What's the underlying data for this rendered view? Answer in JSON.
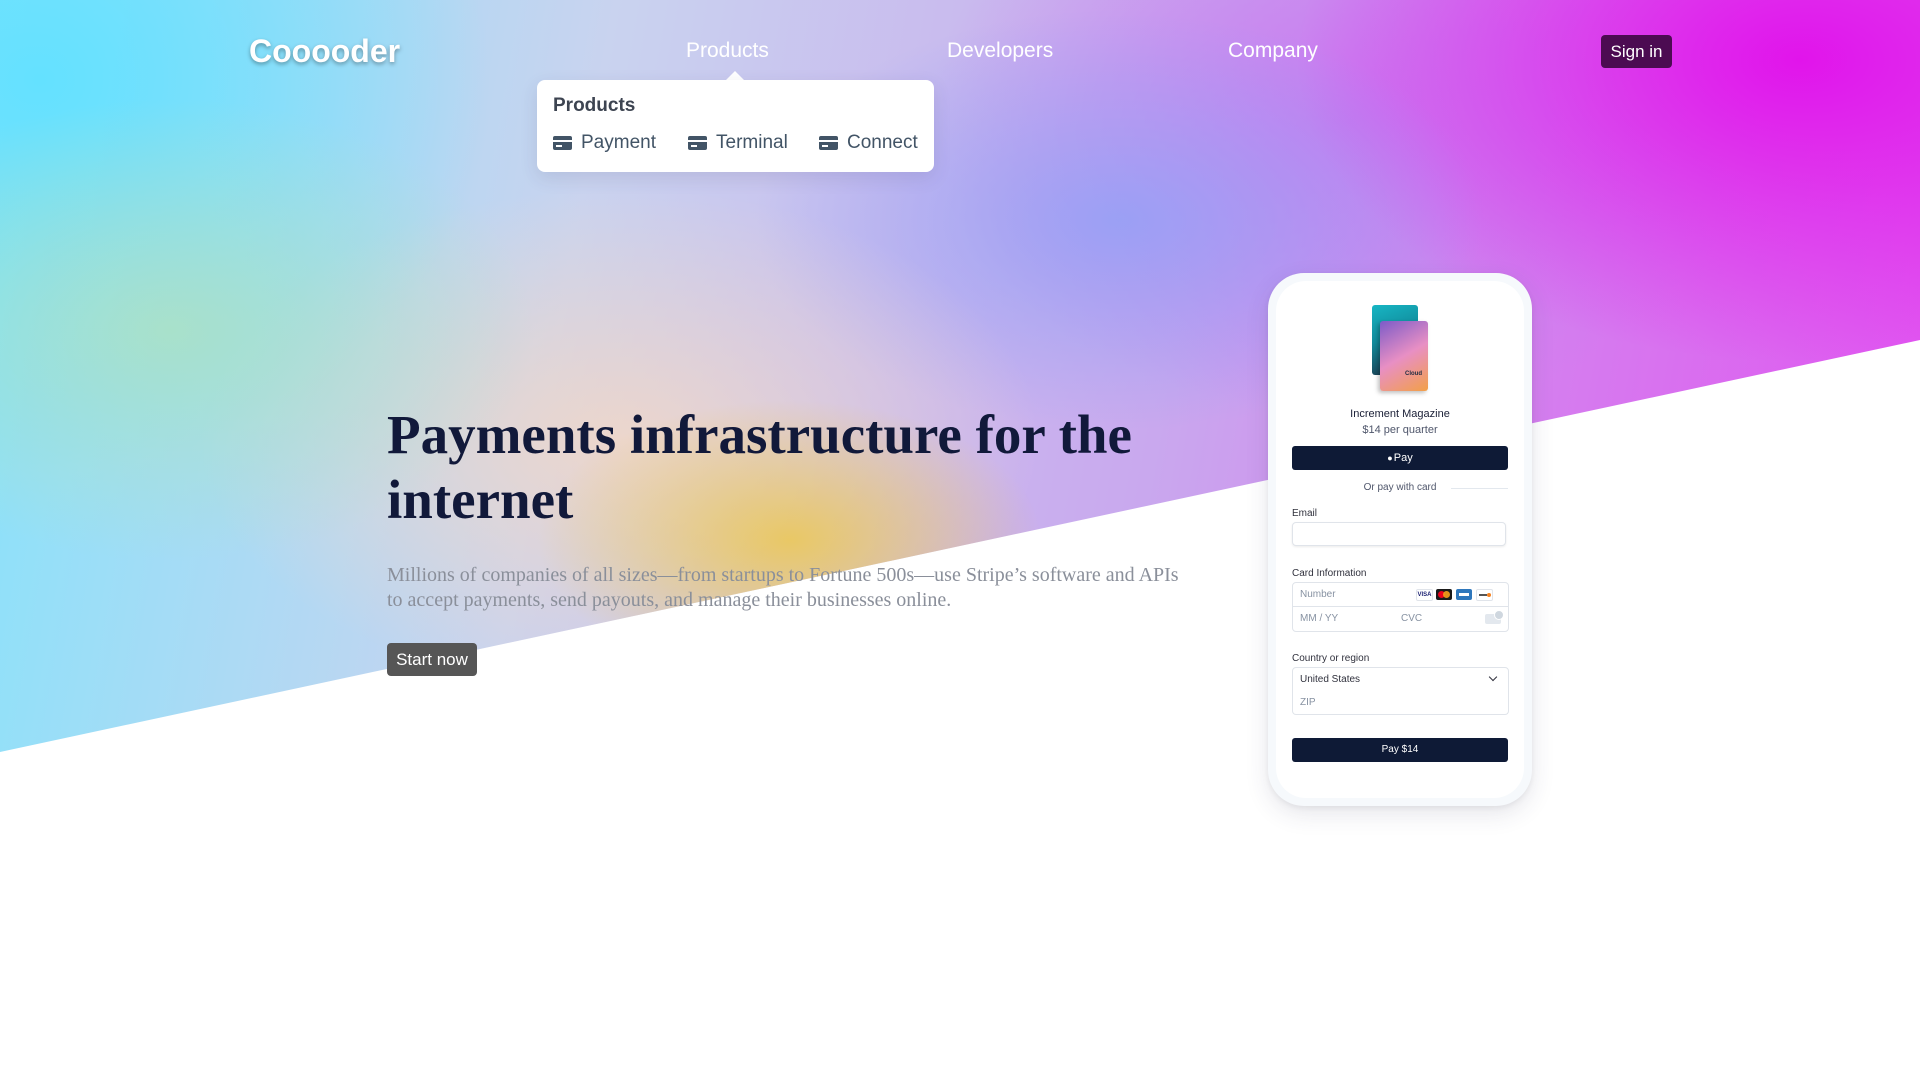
{
  "nav": {
    "logo": "Cooooder",
    "links": [
      "Products",
      "Developers",
      "Company"
    ],
    "signin_label": "Sign in"
  },
  "dropdown": {
    "title": "Products",
    "items": [
      {
        "label": "Payment",
        "icon": "credit-card-icon"
      },
      {
        "label": "Terminal",
        "icon": "credit-card-icon"
      },
      {
        "label": "Connect",
        "icon": "credit-card-icon"
      }
    ]
  },
  "hero": {
    "headline": "Payments infrastructure for the internet",
    "subtext": "Millions of companies of all sizes—from startups to Fortune 500s—use Stripe’s software and APIs to accept payments, send payouts, and manage their businesses online.",
    "cta_label": "Start now"
  },
  "checkout": {
    "product_name": "Increment Magazine",
    "product_price": "$14 per quarter",
    "magazine_cover_text": "Cloud",
    "applepay_label": "Pay",
    "or_text": "Or pay with card",
    "email_label": "Email",
    "email_value": "",
    "card_label": "Card Information",
    "card_number_placeholder": "Number",
    "card_brands": [
      "visa",
      "mastercard",
      "amex",
      "discover"
    ],
    "visa_text": "VISA",
    "expiry_placeholder": "MM / YY",
    "cvc_placeholder": "CVC",
    "country_label": "Country or region",
    "country_value": "United States",
    "zip_placeholder": "ZIP",
    "pay_label": "Pay $14"
  },
  "colors": {
    "signin_bg": "#4c0b52",
    "headline": "#11193a",
    "button_dark": "#0e1a36",
    "cta_bg": "#565656"
  }
}
